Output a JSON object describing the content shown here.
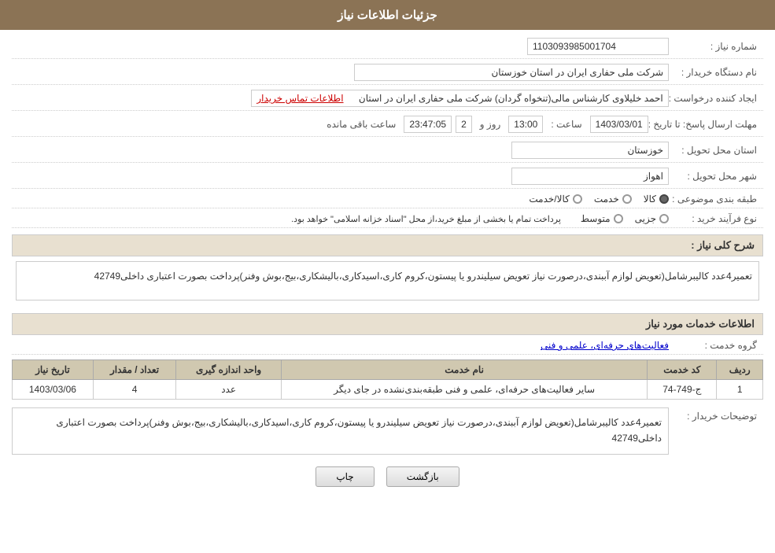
{
  "header": {
    "title": "جزئیات اطلاعات نیاز"
  },
  "fields": {
    "need_number_label": "شماره نیاز :",
    "need_number_value": "1103093985001704",
    "buyer_name_label": "نام دستگاه خریدار :",
    "buyer_name_value": "شرکت ملی حفاری ایران در استان خوزستان",
    "creator_label": "ایجاد کننده درخواست :",
    "creator_value": "احمد خلیلاوی کارشناس مالی(تنخواه گردان) شرکت ملی حفاری ایران در استان",
    "creator_link": "اطلاعات تماس خریدار",
    "deadline_label": "مهلت ارسال پاسخ: تا تاریخ :",
    "deadline_date": "1403/03/01",
    "deadline_time_label": "ساعت :",
    "deadline_time": "13:00",
    "deadline_day_label": "روز و",
    "deadline_days": "2",
    "deadline_remaining_label": "ساعت باقی مانده",
    "deadline_remaining": "23:47:05",
    "province_label": "استان محل تحویل :",
    "province_value": "خوزستان",
    "city_label": "شهر محل تحویل :",
    "city_value": "اهواز",
    "category_label": "طبقه بندی موضوعی :",
    "category_options": [
      {
        "label": "کالا",
        "selected": true
      },
      {
        "label": "خدمت",
        "selected": false
      },
      {
        "label": "کالا/خدمت",
        "selected": false
      }
    ],
    "purchase_type_label": "نوع فرآیند خرید :",
    "purchase_type_options": [
      {
        "label": "جزیی",
        "selected": false
      },
      {
        "label": "متوسط",
        "selected": false
      }
    ],
    "purchase_type_note": "پرداخت تمام یا بخشی از مبلغ خرید،از محل \"اسناد خزانه اسلامی\" خواهد بود.",
    "general_desc_label": "شرح کلی نیاز :",
    "general_desc_value": "تعمیر4عدد کالیبرشامل(تعویض لوازم آببندی،درصورت نیاز تعویض سیلیندرو یا پیستون،کروم کاری،اسیدکاری،بالیشکاری،بیج،بوش وفنر)پرداخت بصورت اعتباری داخلی42749",
    "services_section_title": "اطلاعات خدمات مورد نیاز",
    "service_group_label": "گروه خدمت :",
    "service_group_value": "فعالیت‌های حرفه‌ای، علمی و فنی",
    "table": {
      "headers": [
        "ردیف",
        "کد خدمت",
        "نام خدمت",
        "واحد اندازه گیری",
        "تعداد / مقدار",
        "تاریخ نیاز"
      ],
      "rows": [
        {
          "row_num": "1",
          "code": "ج-749-74",
          "name": "سایر فعالیت‌های حرفه‌ای، علمی و فنی طبقه‌بندی‌نشده در جای دیگر",
          "unit": "عدد",
          "quantity": "4",
          "date": "1403/03/06"
        }
      ]
    },
    "buyer_desc_label": "توضیحات خریدار :",
    "buyer_desc_value": "تعمیر4عدد کالیبرشامل(تعویض لوازم آببندی،درصورت نیاز تعویض سیلیندرو یا پیستون،کروم کاری،اسیدکاری،بالیشکاری،بیج،بوش وفنر)پرداخت بصورت اعتباری داخلی42749"
  },
  "buttons": {
    "print_label": "چاپ",
    "back_label": "بازگشت"
  },
  "colors": {
    "header_bg": "#8b7355",
    "section_bg": "#e8e0d0",
    "table_header_bg": "#d0c8b0"
  }
}
